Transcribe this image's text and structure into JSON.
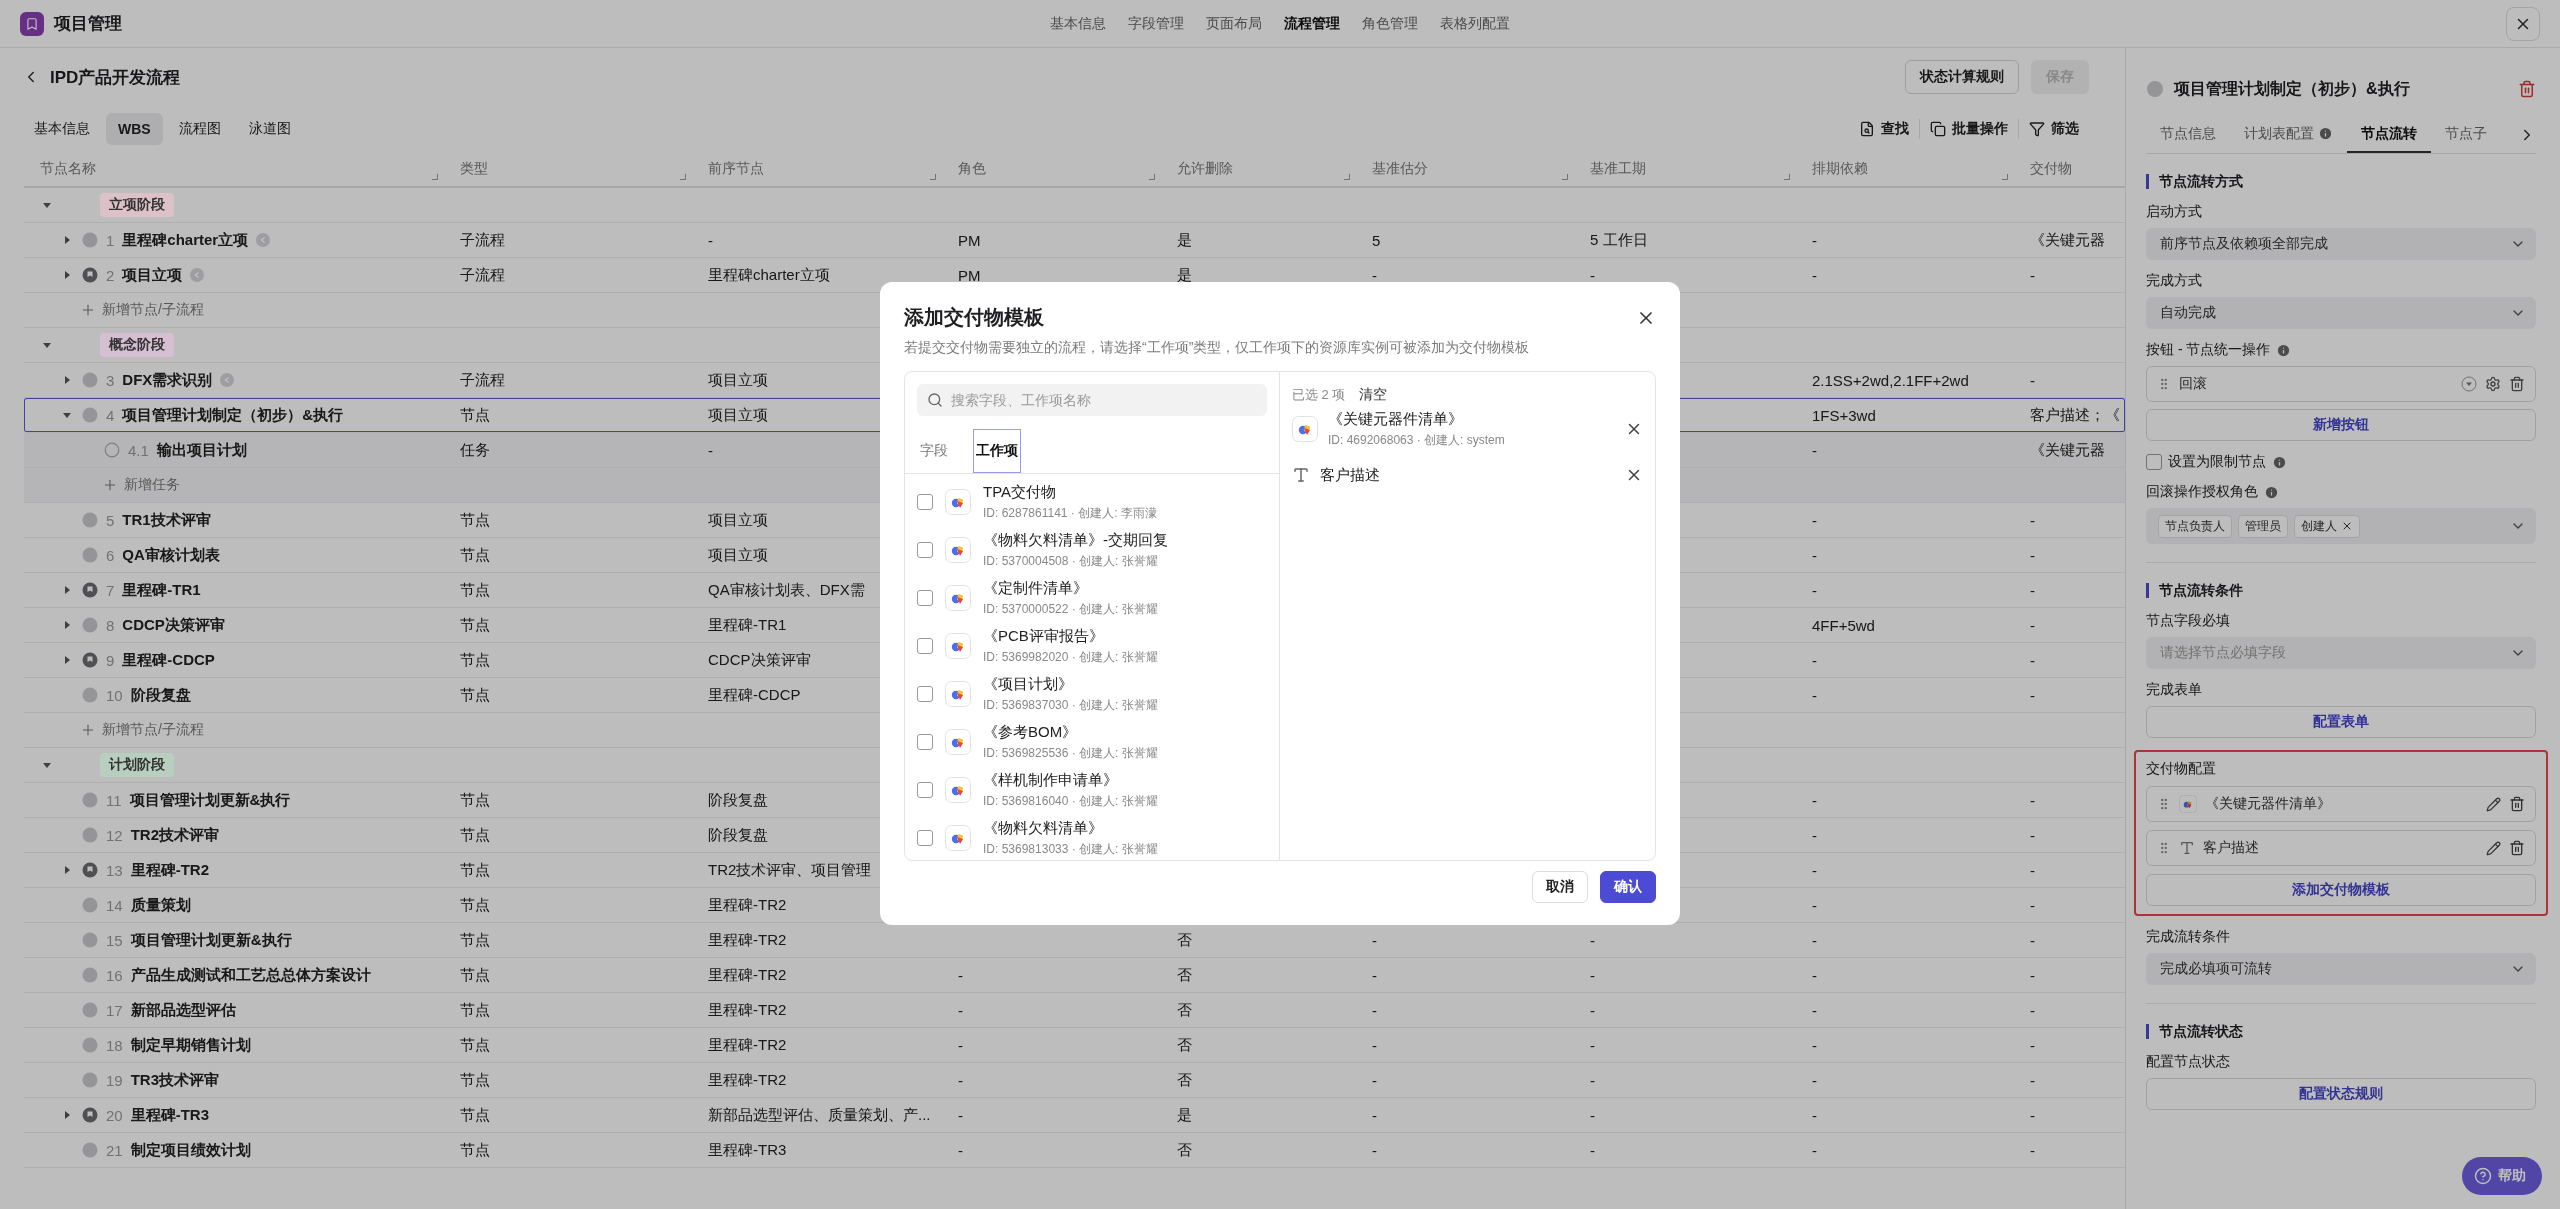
{
  "app": {
    "title": "项目管理"
  },
  "top_nav": [
    {
      "label": "基本信息",
      "selected": false
    },
    {
      "label": "字段管理",
      "selected": false
    },
    {
      "label": "页面布局",
      "selected": false
    },
    {
      "label": "流程管理",
      "selected": true
    },
    {
      "label": "角色管理",
      "selected": false
    },
    {
      "label": "表格列配置",
      "selected": false
    }
  ],
  "page": {
    "title": "IPD产品开发流程",
    "buttons": [
      {
        "label": "状态计算规则",
        "disabled": false
      },
      {
        "label": "保存",
        "disabled": true
      }
    ]
  },
  "view_tabs": [
    {
      "label": "基本信息",
      "selected": false
    },
    {
      "label": "WBS",
      "selected": true
    },
    {
      "label": "流程图",
      "selected": false
    },
    {
      "label": "泳道图",
      "selected": false
    }
  ],
  "toolbar": [
    {
      "label": "查找",
      "kind": "find"
    },
    {
      "label": "批量操作",
      "kind": "batch"
    },
    {
      "label": "筛选",
      "kind": "filter"
    }
  ],
  "table": {
    "columns": [
      "节点名称",
      "类型",
      "前序节点",
      "角色",
      "允许删除",
      "基准估分",
      "基准工期",
      "排期依赖",
      "交付物"
    ],
    "groups": [
      {
        "label": "立项阶段",
        "color": "#dcc1c9",
        "expanded": true,
        "children": [
          {
            "kind": "node",
            "number": "1",
            "name": "里程碑charter立项",
            "linked": true,
            "expanded": false,
            "selected": false,
            "cells": [
              "子流程",
              "-",
              "PM",
              "是",
              "5",
              "5 工作日",
              "-",
              "《关键元器"
            ]
          },
          {
            "kind": "milestone",
            "number": "2",
            "name": "项目立项",
            "linked": true,
            "expanded": false,
            "selected": false,
            "cells": [
              "子流程",
              "里程碑charter立项",
              "PM",
              "是",
              "-",
              "-",
              "-",
              "-"
            ]
          },
          {
            "kind": "add",
            "label": "新增节点/子流程"
          }
        ]
      },
      {
        "label": "概念阶段",
        "color": "#d6bfd2",
        "expanded": true,
        "children": [
          {
            "kind": "node",
            "number": "3",
            "name": "DFX需求识别",
            "linked": true,
            "expanded": false,
            "selected": false,
            "cells": [
              "子流程",
              "项目立项",
              null,
              null,
              null,
              null,
              "2.1SS+2wd,2.1FF+2wd",
              "-"
            ]
          },
          {
            "kind": "node",
            "number": "4",
            "name": "项目管理计划制定（初步）&执行",
            "expanded": true,
            "selected": true,
            "cells": [
              "节点",
              "项目立项",
              null,
              null,
              null,
              null,
              "1FS+3wd",
              "客户描述；《"
            ],
            "children": [
              {
                "kind": "task",
                "number": "4.1",
                "name": "输出项目计划",
                "selected": false,
                "cells": [
                  "任务",
                  "-",
                  null,
                  null,
                  null,
                  null,
                  "-",
                  "《关键元器"
                ]
              },
              {
                "kind": "add",
                "label": "新增任务"
              }
            ]
          },
          {
            "kind": "node",
            "number": "5",
            "name": "TR1技术评审",
            "selected": false,
            "cells": [
              "节点",
              "项目立项",
              null,
              null,
              null,
              null,
              "-",
              "-"
            ]
          },
          {
            "kind": "node",
            "number": "6",
            "name": "QA审核计划表",
            "selected": false,
            "cells": [
              "节点",
              "项目立项",
              null,
              null,
              null,
              null,
              "-",
              "-"
            ]
          },
          {
            "kind": "milestone",
            "number": "7",
            "name": "里程碑-TR1",
            "expanded": false,
            "selected": false,
            "cells": [
              "节点",
              "QA审核计划表、DFX需",
              null,
              null,
              null,
              null,
              "-",
              "-"
            ]
          },
          {
            "kind": "node",
            "number": "8",
            "name": "CDCP决策评审",
            "expanded": false,
            "selected": false,
            "cells": [
              "节点",
              "里程碑-TR1",
              null,
              null,
              null,
              null,
              "4FF+5wd",
              "-"
            ]
          },
          {
            "kind": "milestone",
            "number": "9",
            "name": "里程碑-CDCP",
            "expanded": false,
            "selected": false,
            "cells": [
              "节点",
              "CDCP决策评审",
              null,
              null,
              null,
              null,
              "-",
              "-"
            ]
          },
          {
            "kind": "node",
            "number": "10",
            "name": "阶段复盘",
            "selected": false,
            "cells": [
              "节点",
              "里程碑-CDCP",
              null,
              null,
              null,
              null,
              "-",
              "-"
            ]
          },
          {
            "kind": "add",
            "label": "新增节点/子流程"
          }
        ]
      },
      {
        "label": "计划阶段",
        "color": "#b8cfc0",
        "expanded": true,
        "children": [
          {
            "kind": "node",
            "number": "11",
            "name": "项目管理计划更新&执行",
            "selected": false,
            "cells": [
              "节点",
              "阶段复盘",
              null,
              null,
              null,
              null,
              "-",
              "-"
            ]
          },
          {
            "kind": "node",
            "number": "12",
            "name": "TR2技术评审",
            "selected": false,
            "cells": [
              "节点",
              "阶段复盘",
              null,
              null,
              null,
              null,
              "-",
              "-"
            ]
          },
          {
            "kind": "milestone",
            "number": "13",
            "name": "里程碑-TR2",
            "expanded": false,
            "selected": false,
            "cells": [
              "节点",
              "TR2技术评审、项目管理",
              null,
              null,
              null,
              null,
              "-",
              "-"
            ]
          },
          {
            "kind": "node",
            "number": "14",
            "name": "质量策划",
            "selected": false,
            "cells": [
              "节点",
              "里程碑-TR2",
              null,
              null,
              null,
              null,
              "-",
              "-"
            ]
          },
          {
            "kind": "node",
            "number": "15",
            "name": "项目管理计划更新&执行",
            "selected": false,
            "cells": [
              "节点",
              "里程碑-TR2",
              null,
              "否",
              "-",
              "-",
              "-",
              "-"
            ]
          },
          {
            "kind": "node",
            "number": "16",
            "name": "产品生成测试和工艺总总体方案设计",
            "selected": false,
            "cells": [
              "节点",
              "里程碑-TR2",
              "-",
              "否",
              "-",
              "-",
              "-",
              "-"
            ]
          },
          {
            "kind": "node",
            "number": "17",
            "name": "新部品选型评估",
            "selected": false,
            "cells": [
              "节点",
              "里程碑-TR2",
              "-",
              "否",
              "-",
              "-",
              "-",
              "-"
            ]
          },
          {
            "kind": "node",
            "number": "18",
            "name": "制定早期销售计划",
            "selected": false,
            "cells": [
              "节点",
              "里程碑-TR2",
              "-",
              "否",
              "-",
              "-",
              "-",
              "-"
            ]
          },
          {
            "kind": "node",
            "number": "19",
            "name": "TR3技术评审",
            "selected": false,
            "cells": [
              "节点",
              "里程碑-TR2",
              "-",
              "否",
              "-",
              "-",
              "-",
              "-"
            ]
          },
          {
            "kind": "milestone",
            "number": "20",
            "name": "里程碑-TR3",
            "expanded": false,
            "selected": false,
            "cells": [
              "节点",
              "新部品选型评估、质量策划、产...",
              "-",
              "是",
              "-",
              "-",
              "-",
              "-"
            ]
          },
          {
            "kind": "node",
            "number": "21",
            "name": "制定项目绩效计划",
            "selected": false,
            "cells": [
              "节点",
              "里程碑-TR3",
              "-",
              "否",
              "-",
              "-",
              "-",
              "-"
            ]
          }
        ]
      }
    ]
  },
  "side_panel": {
    "title": "项目管理计划制定（初步）&执行",
    "tabs": [
      {
        "label": "节点信息",
        "selected": false
      },
      {
        "label": "计划表配置",
        "info": true,
        "selected": false
      },
      {
        "label": "节点流转",
        "selected": true
      },
      {
        "label": "节点子",
        "selected": false
      }
    ],
    "sections": [
      {
        "title": "节点流转方式",
        "fields": [
          {
            "kind": "select",
            "label": "启动方式",
            "value": "前序节点及依赖项全部完成"
          },
          {
            "kind": "select",
            "label": "完成方式",
            "value": "自动完成"
          },
          {
            "kind": "actions",
            "label": "按钮 - 节点统一操作",
            "info": true,
            "items": [
              {
                "name": "回滚"
              }
            ],
            "button": "新增按钮"
          },
          {
            "kind": "checkbox",
            "label": "设置为限制节点",
            "info": true,
            "checked": false
          },
          {
            "kind": "tags",
            "label": "回滚操作授权角色",
            "info": true,
            "tags": [
              {
                "label": "节点负责人",
                "removable": false
              },
              {
                "label": "管理员",
                "removable": false
              },
              {
                "label": "创建人",
                "removable": true
              }
            ]
          }
        ]
      },
      {
        "title": "节点流转条件",
        "fields": [
          {
            "kind": "select",
            "label": "节点字段必填",
            "placeholder": "请选择节点必填字段"
          },
          {
            "kind": "button",
            "label": "完成表单",
            "button": "配置表单"
          },
          {
            "kind": "deliverables",
            "label": "交付物配置",
            "highlighted": true,
            "items": [
              {
                "kind": "work_item",
                "name": "《关键元器件清单》"
              },
              {
                "kind": "field",
                "name": "客户描述"
              }
            ],
            "button": "添加交付物模板"
          },
          {
            "kind": "select",
            "label": "完成流转条件",
            "value": "完成必填项可流转"
          }
        ]
      },
      {
        "title": "节点流转状态",
        "fields": [
          {
            "kind": "button",
            "label": "配置节点状态",
            "button": "配置状态规则"
          }
        ]
      }
    ]
  },
  "help_button": {
    "label": "帮助"
  },
  "modal": {
    "title": "添加交付物模板",
    "description": "若提交交付物需要独立的流程，请选择“工作项”类型，仅工作项下的资源库实例可被添加为交付物模板",
    "search": {
      "placeholder": "搜索字段、工作项名称"
    },
    "tabs": [
      {
        "label": "字段",
        "selected": false
      },
      {
        "label": "工作项",
        "selected": true
      }
    ],
    "items": [
      {
        "name": "TPA交付物",
        "meta": "ID: 6287861141 · 创建人: 李雨濛",
        "checked": false
      },
      {
        "name": "《物料欠料清单》-交期回复",
        "meta": "ID: 5370004508 · 创建人: 张誉耀",
        "checked": false
      },
      {
        "name": "《定制件清单》",
        "meta": "ID: 5370000522 · 创建人: 张誉耀",
        "checked": false
      },
      {
        "name": "《PCB评审报告》",
        "meta": "ID: 5369982020 · 创建人: 张誉耀",
        "checked": false
      },
      {
        "name": "《项目计划》",
        "meta": "ID: 5369837030 · 创建人: 张誉耀",
        "checked": false
      },
      {
        "name": "《参考BOM》",
        "meta": "ID: 5369825536 · 创建人: 张誉耀",
        "checked": false
      },
      {
        "name": "《样机制作申请单》",
        "meta": "ID: 5369816040 · 创建人: 张誉耀",
        "checked": false
      },
      {
        "name": "《物料欠料清单》",
        "meta": "ID: 5369813033 · 创建人: 张誉耀",
        "checked": false
      }
    ],
    "selected_count": "已选 2 项",
    "clear": "清空",
    "selected_items": [
      {
        "kind": "work_item",
        "name": "《关键元器件清单》",
        "meta": "ID: 4692068063 · 创建人: system"
      },
      {
        "kind": "field",
        "name": "客户描述"
      }
    ],
    "buttons": [
      {
        "label": "取消",
        "kind": "secondary"
      },
      {
        "label": "确认",
        "kind": "primary"
      }
    ]
  }
}
